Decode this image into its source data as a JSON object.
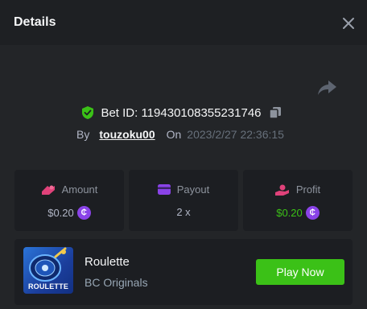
{
  "header": {
    "title": "Details",
    "close_icon": "close-icon"
  },
  "share_icon": "share-icon",
  "bet": {
    "id_text": "Bet ID: 119430108355231746",
    "verified_icon": "shield-check-icon",
    "copy_icon": "copy-icon",
    "by_label": "By",
    "username": "touzoku00",
    "on_label": "On",
    "datetime": "2023/2/27 22:36:15"
  },
  "stats": {
    "amount": {
      "label": "Amount",
      "value": "$0.20",
      "icon": "amount-icon"
    },
    "payout": {
      "label": "Payout",
      "value": "2 x",
      "icon": "payout-card-icon"
    },
    "profit": {
      "label": "Profit",
      "value": "$0.20",
      "icon": "profit-hand-icon"
    },
    "coin_icon": "currency-coin-icon"
  },
  "game": {
    "name": "Roulette",
    "provider": "BC Originals",
    "thumb_label": "ROULETTE",
    "play_label": "Play Now"
  },
  "colors": {
    "background": "#232528",
    "header": "#1e2023",
    "card": "#1c1e22",
    "accent_green": "#3bc117",
    "coin_purple": "#8a43e8",
    "amount_icon": "#e0427a",
    "payout_icon": "#8a43e8",
    "profit_icon": "#e0427a"
  }
}
